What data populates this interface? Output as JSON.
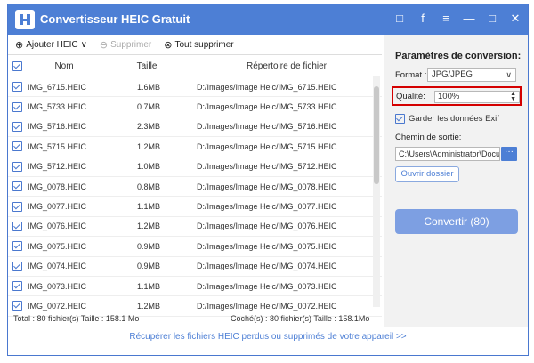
{
  "window": {
    "title": "Convertisseur HEIC Gratuit",
    "icons": {
      "feedback": "□",
      "facebook": "f",
      "menu": "≡",
      "minimize": "—",
      "maximize": "□",
      "close": "✕"
    }
  },
  "toolbar": {
    "add": "Ajouter HEIC",
    "delete": "Supprimer",
    "delete_all": "Tout supprimer",
    "add_icon": "⊕",
    "add_arrow": "∨",
    "delete_icon": "⊖",
    "delete_all_icon": "⊗"
  },
  "table": {
    "columns": [
      "Nom",
      "Taille",
      "Répertoire de fichier"
    ],
    "rows": [
      [
        "IMG_6715.HEIC",
        "1.6MB",
        "D:/Images/Image Heic/IMG_6715.HEIC"
      ],
      [
        "IMG_5733.HEIC",
        "0.7MB",
        "D:/Images/Image Heic/IMG_5733.HEIC"
      ],
      [
        "IMG_5716.HEIC",
        "2.3MB",
        "D:/Images/Image Heic/IMG_5716.HEIC"
      ],
      [
        "IMG_5715.HEIC",
        "1.2MB",
        "D:/Images/Image Heic/IMG_5715.HEIC"
      ],
      [
        "IMG_5712.HEIC",
        "1.0MB",
        "D:/Images/Image Heic/IMG_5712.HEIC"
      ],
      [
        "IMG_0078.HEIC",
        "0.8MB",
        "D:/Images/Image Heic/IMG_0078.HEIC"
      ],
      [
        "IMG_0077.HEIC",
        "1.1MB",
        "D:/Images/Image Heic/IMG_0077.HEIC"
      ],
      [
        "IMG_0076.HEIC",
        "1.2MB",
        "D:/Images/Image Heic/IMG_0076.HEIC"
      ],
      [
        "IMG_0075.HEIC",
        "0.9MB",
        "D:/Images/Image Heic/IMG_0075.HEIC"
      ],
      [
        "IMG_0074.HEIC",
        "0.9MB",
        "D:/Images/Image Heic/IMG_0074.HEIC"
      ],
      [
        "IMG_0073.HEIC",
        "1.1MB",
        "D:/Images/Image Heic/IMG_0073.HEIC"
      ],
      [
        "IMG_0072.HEIC",
        "1.2MB",
        "D:/Images/Image Heic/IMG_0072.HEIC"
      ]
    ]
  },
  "status": {
    "total": "Total : 80 fichier(s) Taille : 158.1 Mo",
    "checked": "Coché(s) : 80 fichier(s) Taille : 158.1Mo"
  },
  "panel": {
    "title": "Paramètres de conversion:",
    "format_label": "Format :",
    "format_value": "JPG/JPEG",
    "quality_label": "Qualité:",
    "quality_value": "100%",
    "exif_label": "Garder les données Exif",
    "output_label": "Chemin de sortie:",
    "output_value": "C:\\Users\\Administrator\\Docu",
    "browse": "···",
    "open_folder": "Ouvrir dossier",
    "convert": "Convertir (80)"
  },
  "footer": {
    "link": "Récupérer les fichiers HEIC perdus ou supprimés de votre appareil >>"
  },
  "colors": {
    "accent": "#4d7fd5",
    "highlight": "#d40000"
  }
}
